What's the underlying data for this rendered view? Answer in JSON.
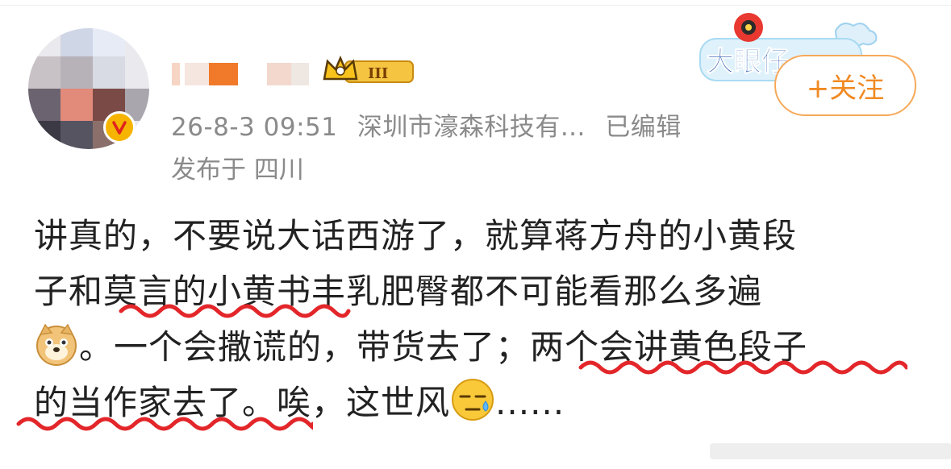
{
  "post": {
    "meta": {
      "time": "26-8-3 09:51",
      "source": "深圳市濠森科技有...",
      "edited": "已编辑",
      "location": "发布于 四川"
    },
    "badge": {
      "level": "III",
      "event_text": "大眼仔"
    },
    "follow_label": "+关注",
    "lines": {
      "l1": "讲真的，不要说大话西游了，就算蒋方舟的小黄段",
      "l2a": "子和",
      "l2b": "莫言的小黄书",
      "l2c": "丰乳肥臀都不可能看那么多遍",
      "l3a": "。一个会撒谎的，带货去了；",
      "l3b": "两个会讲黄色段子",
      "l4a": "的当作家去了。",
      "l4b": "唉，这世风",
      "l4c": "......"
    },
    "emojis": [
      "doge-emoji",
      "sweat-emoji"
    ],
    "colors": {
      "accent": "#f08a24",
      "underline": "#e3262a",
      "meta": "#8a8a8a"
    }
  }
}
